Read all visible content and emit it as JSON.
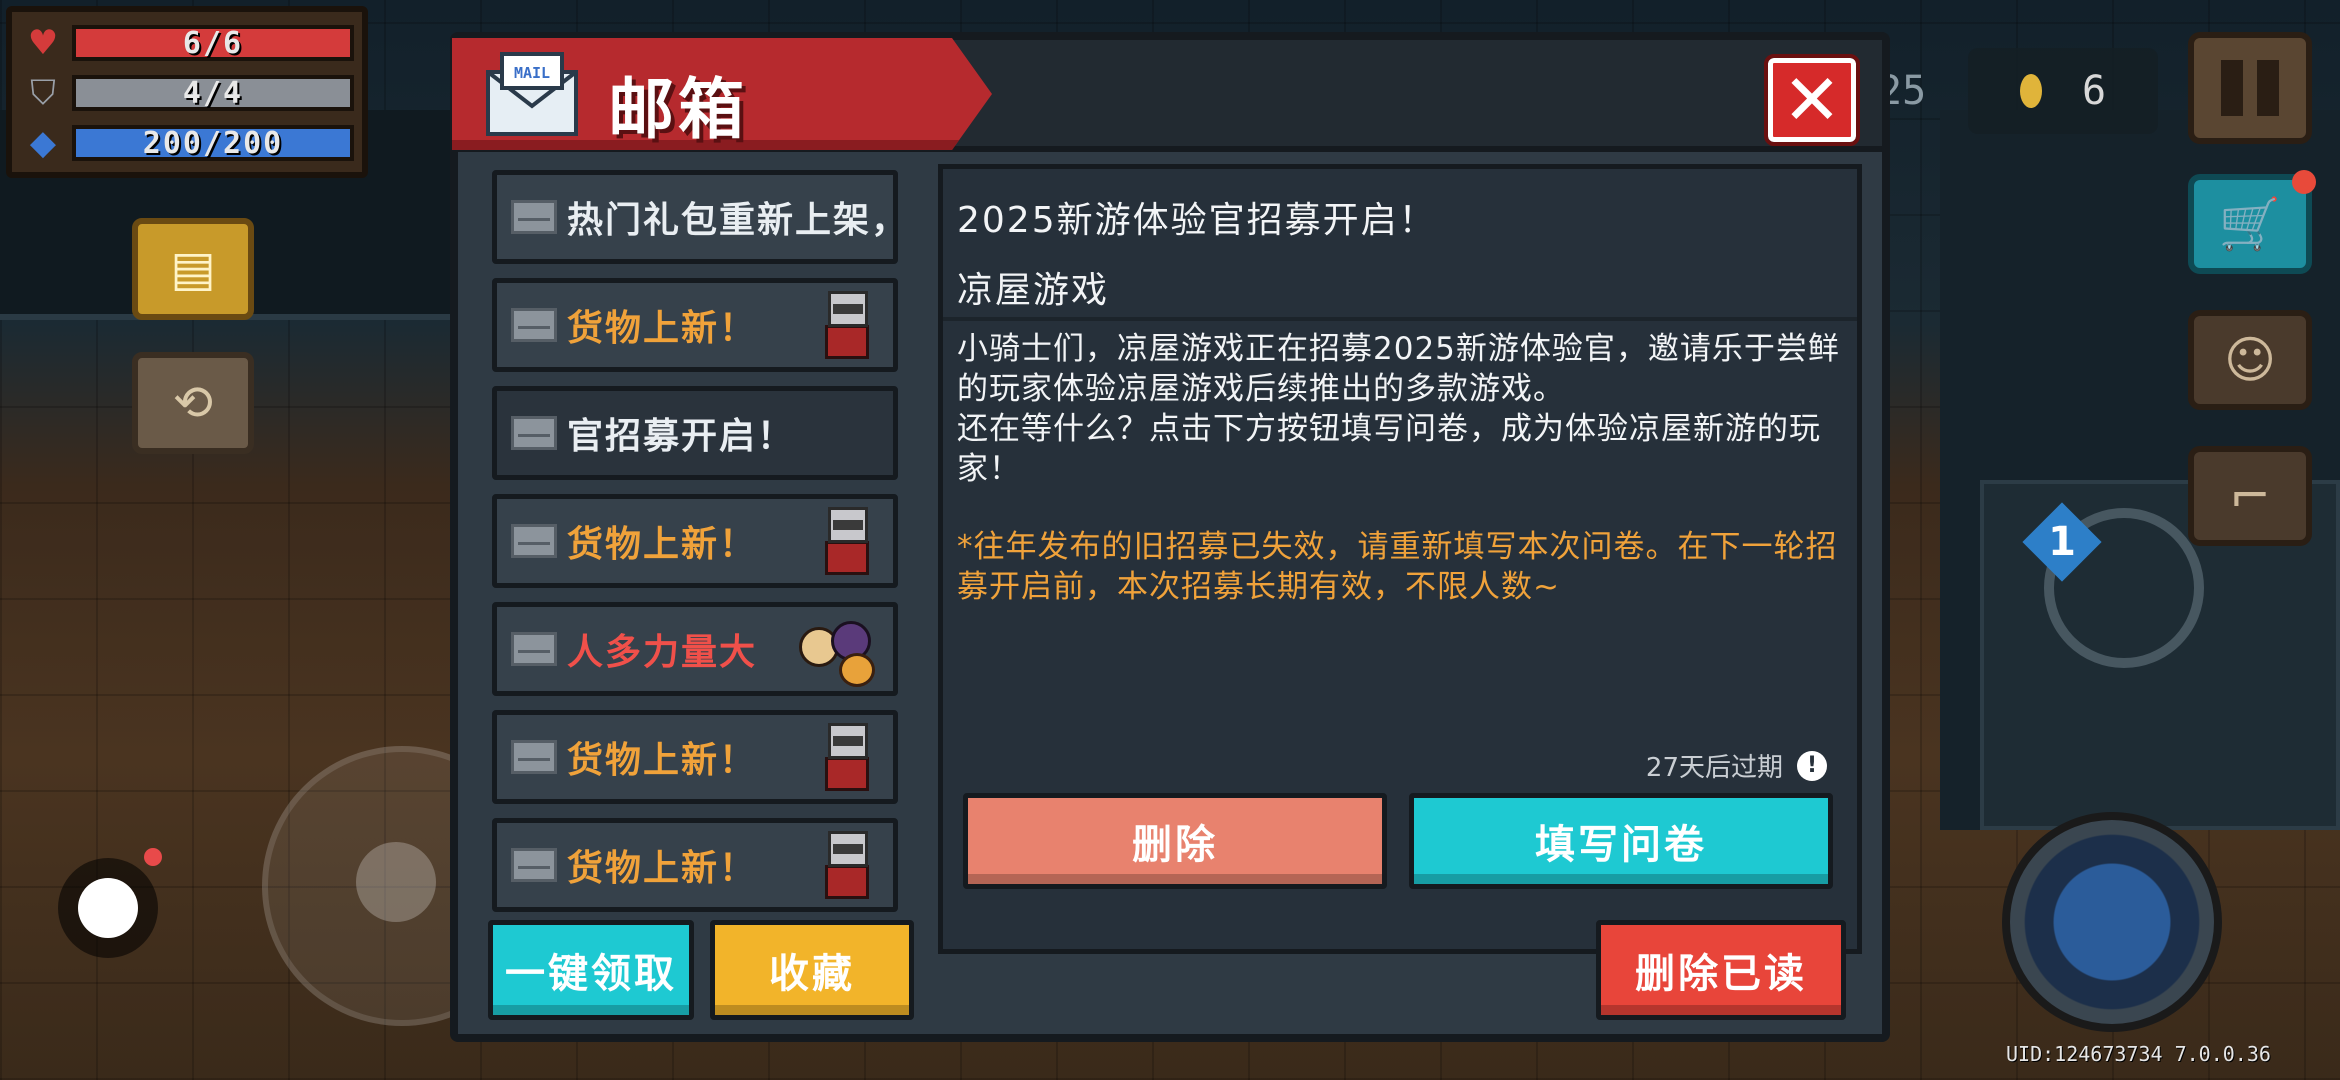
{
  "hud": {
    "hp": {
      "text": "6/6",
      "current": 6,
      "max": 6
    },
    "armor": {
      "text": "4/4",
      "current": 4,
      "max": 4
    },
    "energy": {
      "text": "200/200",
      "current": 200,
      "max": 200
    },
    "gems_partial": "25",
    "coins": "6",
    "uid": "UID:124673734 7.0.0.36",
    "weapon_slot": "1"
  },
  "mailbox": {
    "title": "邮箱",
    "mail_icon_label": "MAIL",
    "close_symbol": "✕",
    "items": [
      {
        "text": "热门礼包重新上架，",
        "color": "white",
        "badge": "none"
      },
      {
        "text": "货物上新！",
        "color": "orange",
        "badge": "cat"
      },
      {
        "text": "官招募开启！",
        "color": "white",
        "badge": "none",
        "selected": true
      },
      {
        "text": "货物上新！",
        "color": "orange",
        "badge": "cat"
      },
      {
        "text": "人多力量大",
        "color": "red",
        "badge": "group"
      },
      {
        "text": "货物上新！",
        "color": "orange",
        "badge": "cat"
      },
      {
        "text": "货物上新！",
        "color": "orange",
        "badge": "cat"
      }
    ],
    "detail": {
      "title": "2025新游体验官招募开启！",
      "sender": "凉屋游戏",
      "body_line1": "小骑士们，凉屋游戏正在招募2025新游体验官，邀请乐于尝鲜的玩家体验凉屋游戏后续推出的多款游戏。",
      "body_line2": "还在等什么？点击下方按钮填写问卷，成为体验凉屋新游的玩家！",
      "note": "*往年发布的旧招募已失效，请重新填写本次问卷。在下一轮招募开启前，本次招募长期有效，不限人数~",
      "expire": "27天后过期",
      "expire_icon": "!",
      "delete_label": "删除",
      "survey_label": "填写问卷"
    },
    "footer": {
      "claim_all": "一键领取",
      "favorite": "收藏",
      "delete_read": "删除已读"
    }
  },
  "colors": {
    "ribbon": "#b62a2e",
    "panel": "#2f3a44",
    "cyan_button": "#1ec9d2",
    "salmon_button": "#e8826e",
    "yellow_button": "#f2b42a",
    "red_button": "#e8453a",
    "orange_text": "#f0a23a",
    "red_text": "#f0504a"
  }
}
